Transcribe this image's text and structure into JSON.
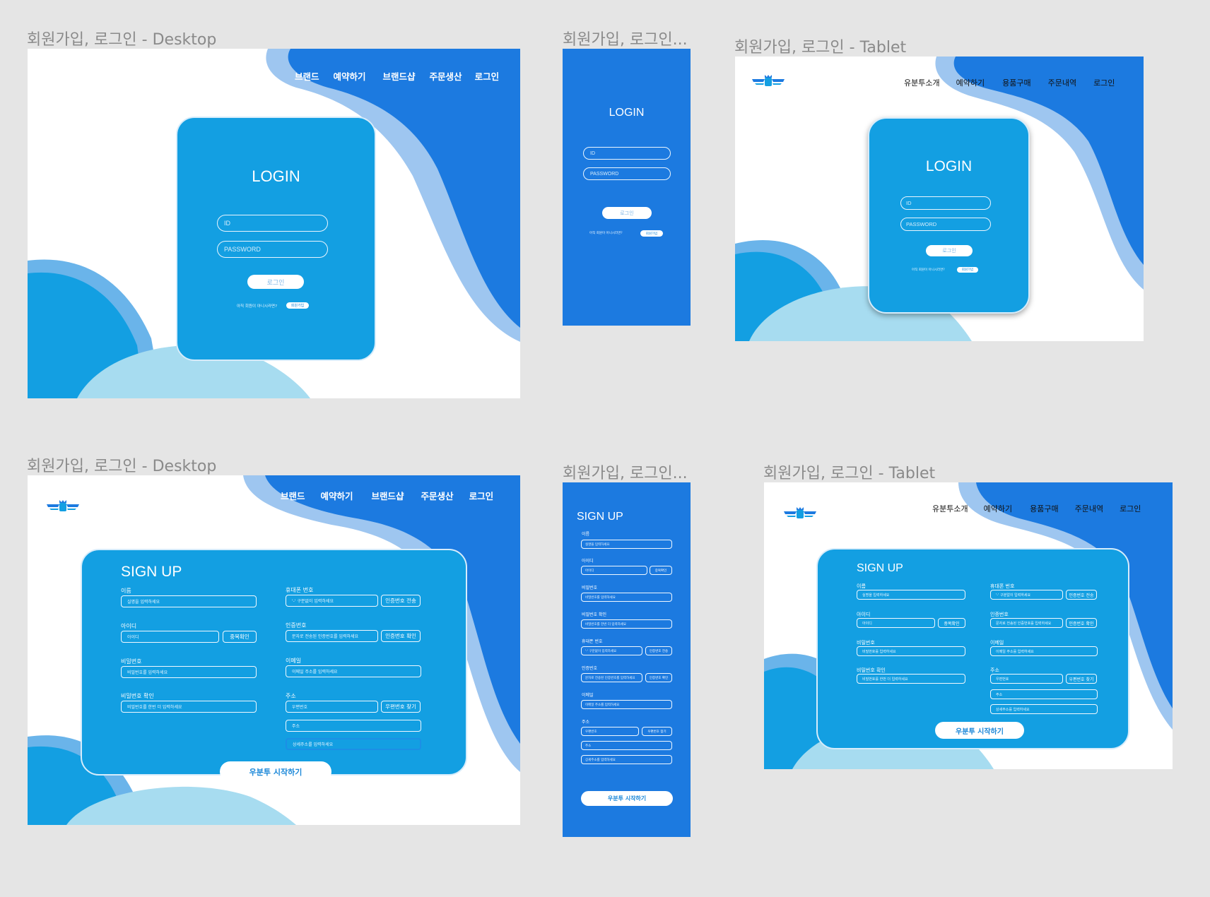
{
  "frames": {
    "login_desktop": {
      "title": "회원가입, 로그인 - Desktop"
    },
    "login_mobile": {
      "title": "회원가입, 로그인..."
    },
    "login_tablet": {
      "title": "회원가입, 로그인 - Tablet"
    },
    "signup_desktop": {
      "title": "회원가입, 로그인 - Desktop"
    },
    "signup_mobile": {
      "title": "회원가입, 로그인..."
    },
    "signup_tablet": {
      "title": "회원가입, 로그인 - Tablet"
    }
  },
  "nav_desktop": [
    "브랜드",
    "예약하기",
    "브랜드샵",
    "주문생산",
    "로그인"
  ],
  "nav_tablet": [
    "유분투소개",
    "예약하기",
    "용품구매",
    "주문내역",
    "로그인"
  ],
  "login": {
    "title": "LOGIN",
    "id_placeholder": "ID",
    "password_placeholder": "PASSWORD",
    "submit": "로그인",
    "not_member": "아직 회원이 아니시라면?",
    "signup": "회원가입"
  },
  "signup": {
    "title": "SIGN UP",
    "name_label": "이름",
    "name_placeholder": "실명을 입력하세요",
    "id_label": "아이디",
    "id_placeholder": "아이디",
    "id_check": "중복확인",
    "password_label": "비밀번호",
    "password_placeholder": "비밀번호를 입력하세요",
    "password_confirm_label": "비밀번호 확인",
    "password_confirm_placeholder": "비밀번호를 한번 더 입력하세요",
    "phone_label": "휴대폰 번호",
    "phone_placeholder": "'-' 구분없이 입력하세요",
    "phone_send": "인증번호 전송",
    "verify_label": "인증번호",
    "verify_placeholder": "문자로 전송된 인증번호를 입력하세요",
    "verify_check": "인증번호 확인",
    "email_label": "이메일",
    "email_placeholder": "이메일 주소를 입력하세요",
    "address_label": "주소",
    "zip_placeholder": "우편번호",
    "zip_find": "우편번호 찾기",
    "address_placeholder": "주소",
    "address_detail_placeholder": "상세주소를 입력하세요",
    "start": "우분투 시작하기"
  },
  "colors": {
    "canvas": "#e5e5e5",
    "blue_dark": "#1c7ae0",
    "blue_card": "#139fe2",
    "blue_light": "#9ec6f0",
    "sky": "#a7dcf0"
  }
}
